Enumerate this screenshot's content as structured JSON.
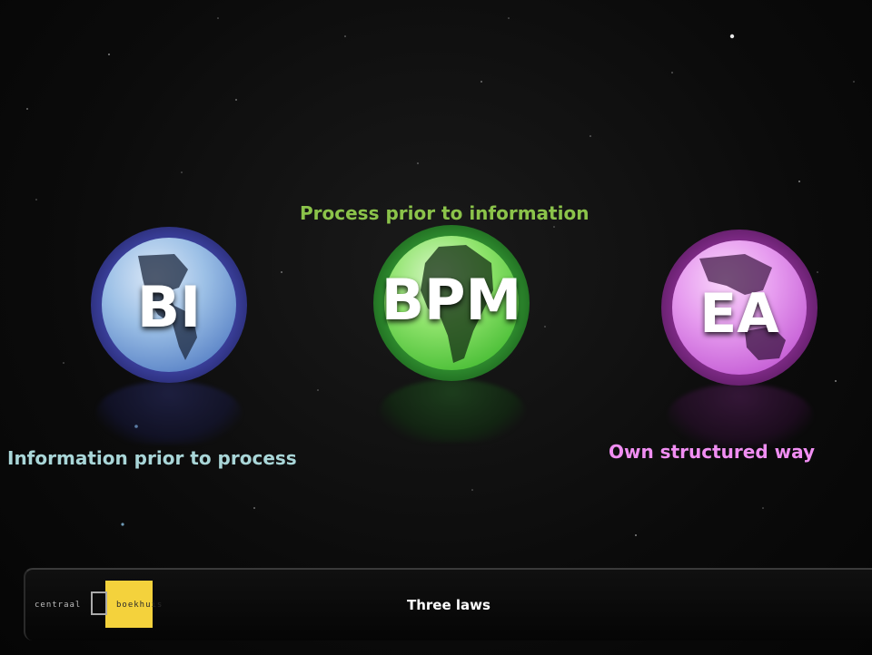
{
  "captions": {
    "bpm": "Process prior to information",
    "bi": "Information prior to process",
    "ea": "Own structured way"
  },
  "globes": {
    "bi": {
      "label": "BI",
      "color": "#3a3f9a"
    },
    "bpm": {
      "label": "BPM",
      "color": "#2e8a2e"
    },
    "ea": {
      "label": "EA",
      "color": "#7e2a86"
    }
  },
  "footer": {
    "title": "Three laws",
    "logo_text_left": "centraal",
    "logo_text_right": "boekhuis",
    "logo_accent": "#f4d23c"
  },
  "caption_colors": {
    "bpm": "#8bc34a",
    "bi": "#a9d6d8",
    "ea": "#f08ef2"
  }
}
